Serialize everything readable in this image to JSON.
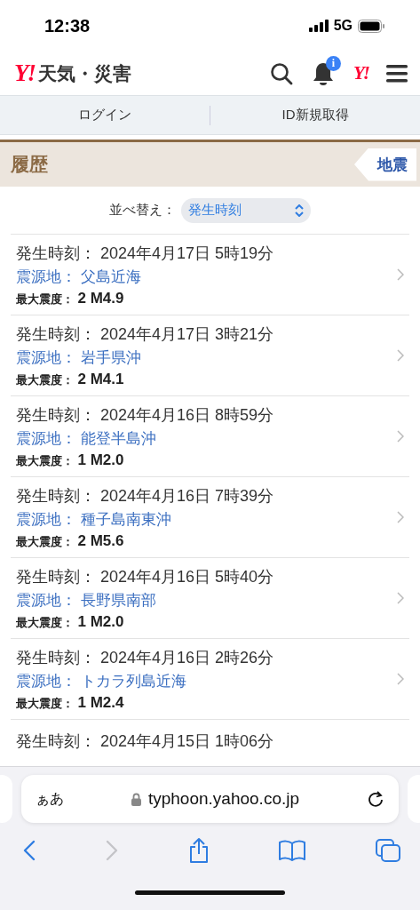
{
  "status_bar": {
    "time": "12:38",
    "network": "5G"
  },
  "header": {
    "logo": "Y!",
    "service": "天気・災害",
    "badge": "i",
    "yahoo_mark": "Y!"
  },
  "account_links": [
    "ログイン",
    "ID新規取得"
  ],
  "section": {
    "title": "履歴",
    "tag": "地震"
  },
  "sort": {
    "label": "並べ替え：",
    "value": "発生時刻"
  },
  "quakes": [
    {
      "time_label": "発生時刻：",
      "time": "2024年4月17日 5時19分",
      "epicenter_label": "震源地：",
      "epicenter": "父島近海",
      "intensity_label": "最大震度：",
      "intensity": "2",
      "magnitude": "M4.9"
    },
    {
      "time_label": "発生時刻：",
      "time": "2024年4月17日 3時21分",
      "epicenter_label": "震源地：",
      "epicenter": "岩手県沖",
      "intensity_label": "最大震度：",
      "intensity": "2",
      "magnitude": "M4.1"
    },
    {
      "time_label": "発生時刻：",
      "time": "2024年4月16日 8時59分",
      "epicenter_label": "震源地：",
      "epicenter": "能登半島沖",
      "intensity_label": "最大震度：",
      "intensity": "1",
      "magnitude": "M2.0"
    },
    {
      "time_label": "発生時刻：",
      "time": "2024年4月16日 7時39分",
      "epicenter_label": "震源地：",
      "epicenter": "種子島南東沖",
      "intensity_label": "最大震度：",
      "intensity": "2",
      "magnitude": "M5.6"
    },
    {
      "time_label": "発生時刻：",
      "time": "2024年4月16日 5時40分",
      "epicenter_label": "震源地：",
      "epicenter": "長野県南部",
      "intensity_label": "最大震度：",
      "intensity": "1",
      "magnitude": "M2.0"
    },
    {
      "time_label": "発生時刻：",
      "time": "2024年4月16日 2時26分",
      "epicenter_label": "震源地：",
      "epicenter": "トカラ列島近海",
      "intensity_label": "最大震度：",
      "intensity": "1",
      "magnitude": "M2.4"
    },
    {
      "time_label": "発生時刻：",
      "time": "2024年4月15日 1時06分"
    }
  ],
  "browser": {
    "text_size": "ぁあ",
    "url": "typhoon.yahoo.co.jp",
    "back_disabled": false,
    "forward_disabled": true
  }
}
